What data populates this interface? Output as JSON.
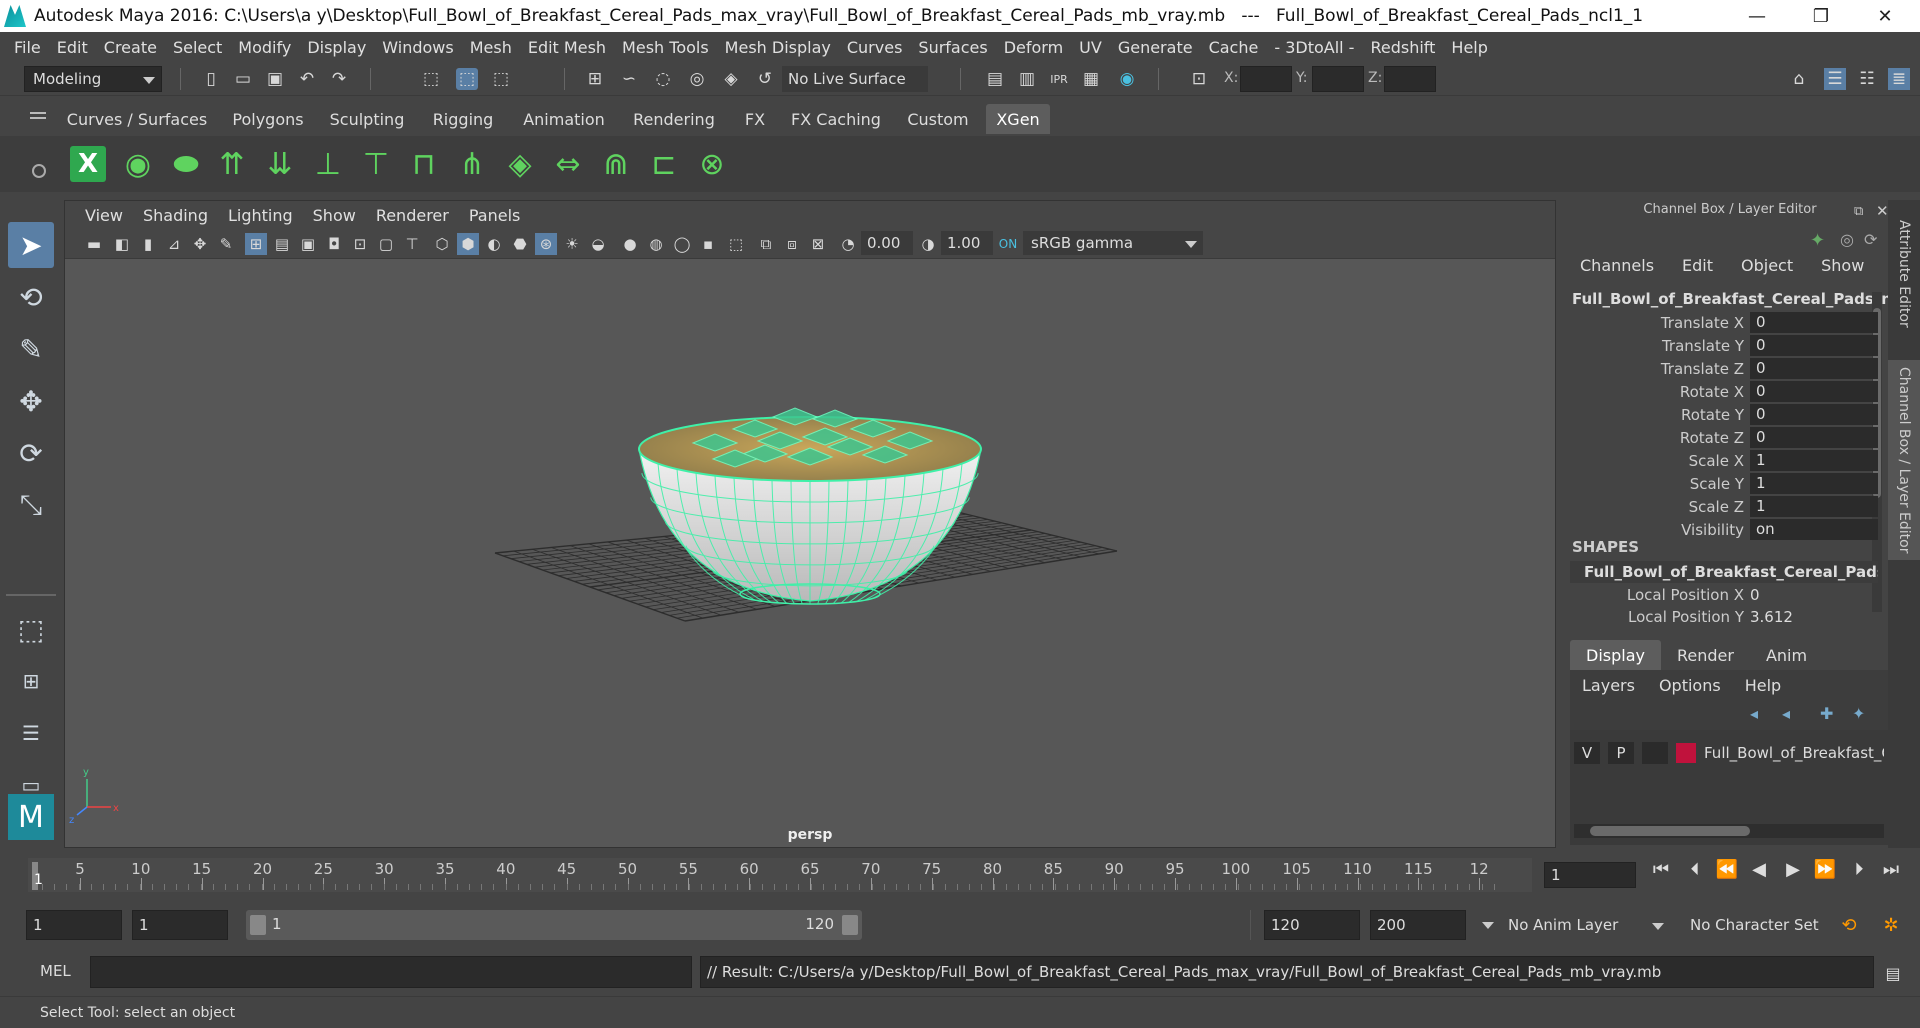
{
  "window": {
    "title": "Autodesk Maya 2016: C:\\Users\\a y\\Desktop\\Full_Bowl_of_Breakfast_Cereal_Pads_max_vray\\Full_Bowl_of_Breakfast_Cereal_Pads_mb_vray.mb   ---   Full_Bowl_of_Breakfast_Cereal_Pads_ncl1_1",
    "minimize": "—",
    "maximize": "❐",
    "close": "✕"
  },
  "menubar": [
    "File",
    "Edit",
    "Create",
    "Select",
    "Modify",
    "Display",
    "Windows",
    "Mesh",
    "Edit Mesh",
    "Mesh Tools",
    "Mesh Display",
    "Curves",
    "Surfaces",
    "Deform",
    "UV",
    "Generate",
    "Cache",
    "- 3DtoAll -",
    "Redshift",
    "Help"
  ],
  "statusline": {
    "mode": "Modeling",
    "live_surface": "No Live Surface",
    "x_label": "X:",
    "y_label": "Y:",
    "z_label": "Z:"
  },
  "shelf_tabs": [
    "Curves / Surfaces",
    "Polygons",
    "Sculpting",
    "Rigging",
    "Animation",
    "Rendering",
    "FX",
    "FX Caching",
    "Custom",
    "XGen"
  ],
  "shelf_active": "XGen",
  "viewport": {
    "menu": [
      "View",
      "Shading",
      "Lighting",
      "Show",
      "Renderer",
      "Panels"
    ],
    "exposure": "0.00",
    "gamma": "1.00",
    "color_space": "sRGB gamma",
    "camera_label": "persp"
  },
  "channel_box": {
    "title": "Channel Box / Layer Editor",
    "menu": [
      "Channels",
      "Edit",
      "Object",
      "Show"
    ],
    "object_name": "Full_Bowl_of_Breakfast_Cereal_Pads_n...",
    "channels": [
      {
        "label": "Translate X",
        "value": "0"
      },
      {
        "label": "Translate Y",
        "value": "0"
      },
      {
        "label": "Translate Z",
        "value": "0"
      },
      {
        "label": "Rotate X",
        "value": "0"
      },
      {
        "label": "Rotate Y",
        "value": "0"
      },
      {
        "label": "Rotate Z",
        "value": "0"
      },
      {
        "label": "Scale X",
        "value": "1"
      },
      {
        "label": "Scale Y",
        "value": "1"
      },
      {
        "label": "Scale Z",
        "value": "1"
      },
      {
        "label": "Visibility",
        "value": "on"
      }
    ],
    "shapes_header": "SHAPES",
    "shape_name": "Full_Bowl_of_Breakfast_Cereal_Pads...",
    "shape_channels": [
      {
        "label": "Local Position X",
        "value": "0"
      },
      {
        "label": "Local Position Y",
        "value": "3.612"
      }
    ]
  },
  "layer_editor": {
    "tabs": [
      "Display",
      "Render",
      "Anim"
    ],
    "active_tab": "Display",
    "menu": [
      "Layers",
      "Options",
      "Help"
    ],
    "layer": {
      "v": "V",
      "p": "P",
      "name": "Full_Bowl_of_Breakfast_C",
      "color": "#c0123c"
    }
  },
  "side_tabs": [
    "Attribute Editor",
    "Channel Box / Layer Editor"
  ],
  "timeline": {
    "ticks": [
      "5",
      "10",
      "15",
      "20",
      "25",
      "30",
      "35",
      "40",
      "45",
      "50",
      "55",
      "60",
      "65",
      "70",
      "75",
      "80",
      "85",
      "90",
      "95",
      "100",
      "105",
      "110",
      "115",
      "12"
    ],
    "start_marker": "1",
    "current_frame": "1"
  },
  "range": {
    "start": "1",
    "inner_start": "1",
    "slider_start": "1",
    "slider_end": "120",
    "end": "120",
    "outer_end": "200",
    "anim_layer": "No Anim Layer",
    "char_set": "No Character Set"
  },
  "command": {
    "lang": "MEL",
    "result": "// Result: C:/Users/a y/Desktop/Full_Bowl_of_Breakfast_Cereal_Pads_max_vray/Full_Bowl_of_Breakfast_Cereal_Pads_mb_vray.mb"
  },
  "help_line": "Select Tool: select an object",
  "colors": {
    "accent": "#5d5d5d",
    "wire": "#3ff0a8",
    "layer": "#c0123c"
  }
}
